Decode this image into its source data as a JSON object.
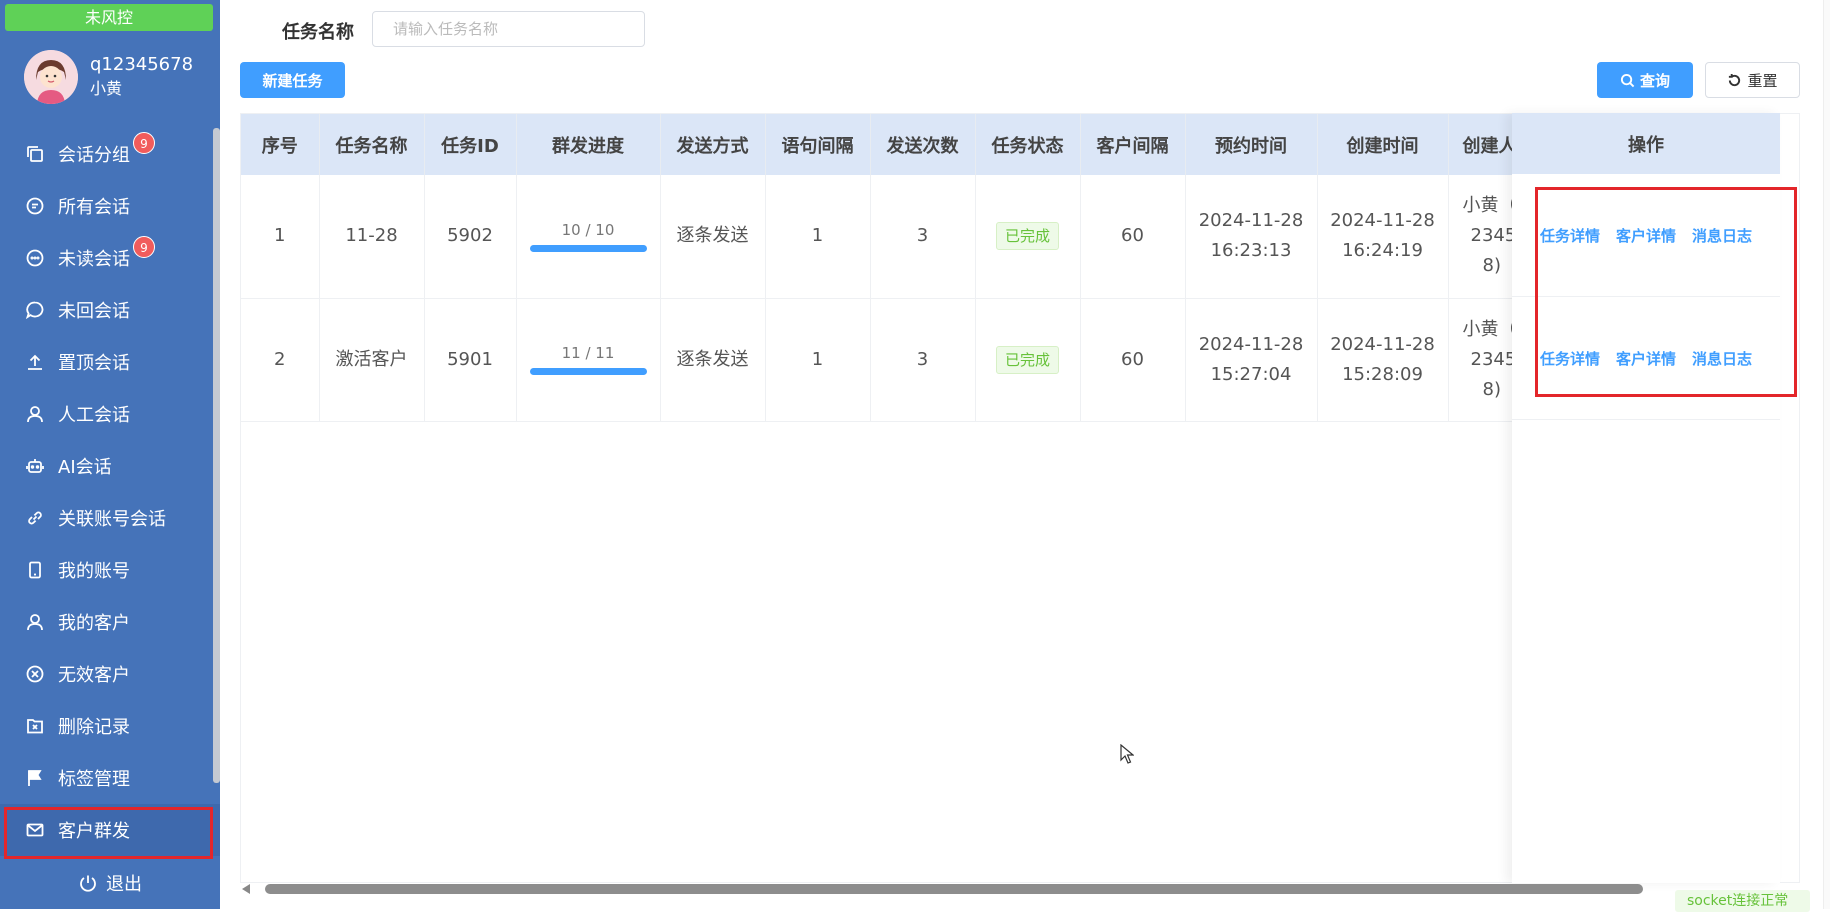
{
  "sidebar": {
    "risk_badge": "未风控",
    "user": {
      "id": "q12345678",
      "name": "小黄"
    },
    "items": [
      {
        "label": "会话分组",
        "icon": "copy-icon",
        "count": "9"
      },
      {
        "label": "所有会话",
        "icon": "chat-icon",
        "count": ""
      },
      {
        "label": "未读会话",
        "icon": "chat-dots-icon",
        "count": "9"
      },
      {
        "label": "未回会话",
        "icon": "chat-bubble-icon",
        "count": ""
      },
      {
        "label": "置顶会话",
        "icon": "upload-icon",
        "count": ""
      },
      {
        "label": "人工会话",
        "icon": "user-icon",
        "count": ""
      },
      {
        "label": "AI会话",
        "icon": "robot-icon",
        "count": ""
      },
      {
        "label": "关联账号会话",
        "icon": "link-icon",
        "count": ""
      },
      {
        "label": "我的账号",
        "icon": "phone-icon",
        "count": ""
      },
      {
        "label": "我的客户",
        "icon": "user-icon",
        "count": ""
      },
      {
        "label": "无效客户",
        "icon": "circle-x-icon",
        "count": ""
      },
      {
        "label": "删除记录",
        "icon": "box-x-icon",
        "count": ""
      },
      {
        "label": "标签管理",
        "icon": "flag-icon",
        "count": ""
      },
      {
        "label": "客户群发",
        "icon": "mail-icon",
        "count": "",
        "active": true
      }
    ],
    "logout": "退出"
  },
  "filter": {
    "label": "任务名称",
    "placeholder": "请输入任务名称",
    "value": ""
  },
  "toolbar": {
    "new_task": "新建任务",
    "query": "查询",
    "reset": "重置"
  },
  "table": {
    "headers": [
      "序号",
      "任务名称",
      "任务ID",
      "群发进度",
      "发送方式",
      "语句间隔",
      "发送次数",
      "任务状态",
      "客户间隔",
      "预约时间",
      "创建时间",
      "创建人",
      "操作"
    ],
    "rows": [
      {
        "index": "1",
        "name": "11-28",
        "id": "5902",
        "progress": "10 / 10",
        "progress_fraction": 1.0,
        "method": "逐条发送",
        "sentence_interval": "1",
        "send_count": "3",
        "status": "已完成",
        "customer_interval": "60",
        "schedule_date": "2024-11-28",
        "schedule_time": "16:23:13",
        "created_date": "2024-11-28",
        "created_time": "16:24:19",
        "creator_l1": "小黄（",
        "creator_l2": "2345",
        "creator_l3": "8)"
      },
      {
        "index": "2",
        "name": "激活客户",
        "id": "5901",
        "progress": "11 / 11",
        "progress_fraction": 1.0,
        "method": "逐条发送",
        "sentence_interval": "1",
        "send_count": "3",
        "status": "已完成",
        "customer_interval": "60",
        "schedule_date": "2024-11-28",
        "schedule_time": "15:27:04",
        "created_date": "2024-11-28",
        "created_time": "15:28:09",
        "creator_l1": "小黄（",
        "creator_l2": "2345",
        "creator_l3": "8)"
      }
    ],
    "actions": [
      "任务详情",
      "客户详情",
      "消息日志"
    ]
  },
  "status_bar": {
    "socket": "socket连接正常"
  },
  "colors": {
    "sidebar_bg": "#4573b9",
    "primary": "#409eff",
    "success": "#67c23a",
    "highlight": "#e3262a",
    "badge": "#f15c5c"
  }
}
